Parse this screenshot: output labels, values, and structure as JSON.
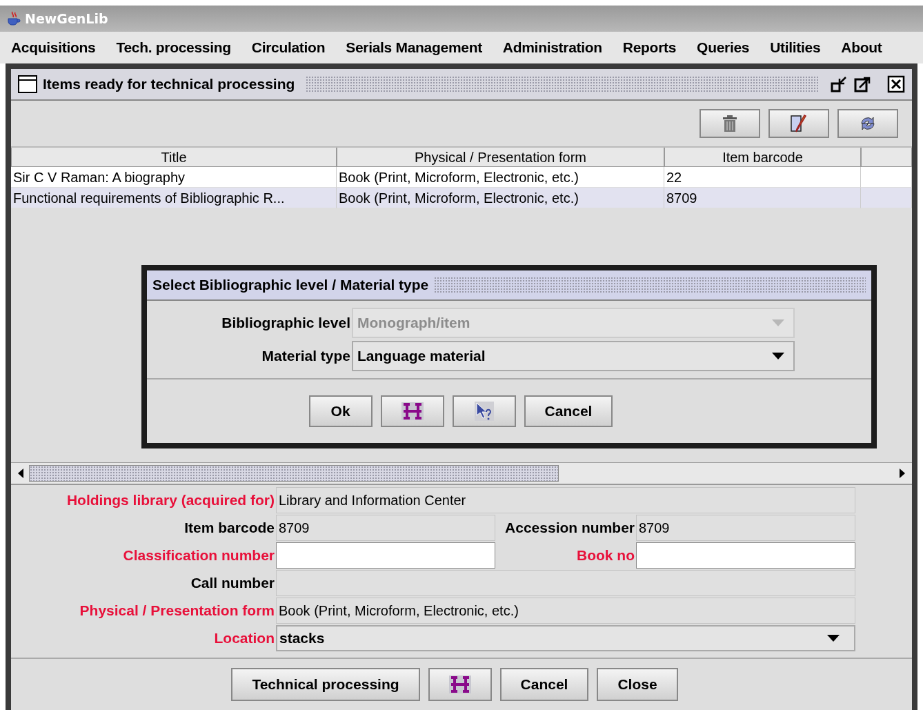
{
  "app": {
    "title": "NewGenLib"
  },
  "menu": [
    "Acquisitions",
    "Tech. processing",
    "Circulation",
    "Serials Management",
    "Administration",
    "Reports",
    "Queries",
    "Utilities",
    "About"
  ],
  "frame": {
    "title": "Items ready for technical processing"
  },
  "table": {
    "columns": [
      "Title",
      "Physical / Presentation form",
      "Item barcode"
    ],
    "rows": [
      {
        "cells": [
          "Sir C V Raman: A biography",
          "Book (Print, Microform, Electronic, etc.)",
          "22"
        ],
        "selected": false
      },
      {
        "cells": [
          "Functional requirements of Bibliographic R...",
          "Book (Print, Microform, Electronic, etc.)",
          "8709"
        ],
        "selected": true
      }
    ]
  },
  "dialog": {
    "title": "Select Bibliographic level / Material type",
    "fields": [
      {
        "label": "Bibliographic level",
        "value": "Monograph/item",
        "disabled": true
      },
      {
        "label": "Material type",
        "value": "Language material",
        "disabled": false
      }
    ],
    "buttons": [
      {
        "kind": "text",
        "label": "Ok"
      },
      {
        "kind": "hyphen"
      },
      {
        "kind": "help"
      },
      {
        "kind": "text",
        "label": "Cancel"
      }
    ]
  },
  "form": {
    "rows": [
      [
        {
          "label": "Holdings library (acquired for)",
          "required": true,
          "kind": "readonly",
          "value": "Library and Information Center"
        }
      ],
      [
        {
          "label": "Item barcode",
          "required": false,
          "kind": "readonly",
          "value": "8709"
        },
        {
          "label": "Accession number",
          "required": false,
          "kind": "readonly",
          "value": "8709"
        }
      ],
      [
        {
          "label": "Classification number",
          "required": true,
          "kind": "input"
        },
        {
          "label": "Book no",
          "required": true,
          "kind": "input"
        }
      ],
      [
        {
          "label": "Call number",
          "required": false,
          "kind": "readonly"
        }
      ],
      [
        {
          "label": "Physical / Presentation form",
          "required": true,
          "kind": "readonly",
          "value": "Book (Print, Microform, Electronic, etc.)"
        }
      ],
      [
        {
          "label": "Location",
          "required": true,
          "kind": "dropdown",
          "value": "stacks"
        }
      ]
    ]
  },
  "buttons": [
    {
      "kind": "text",
      "label": "Technical processing"
    },
    {
      "kind": "hyphen"
    },
    {
      "kind": "text",
      "label": "Cancel"
    },
    {
      "kind": "text",
      "label": "Close"
    }
  ]
}
